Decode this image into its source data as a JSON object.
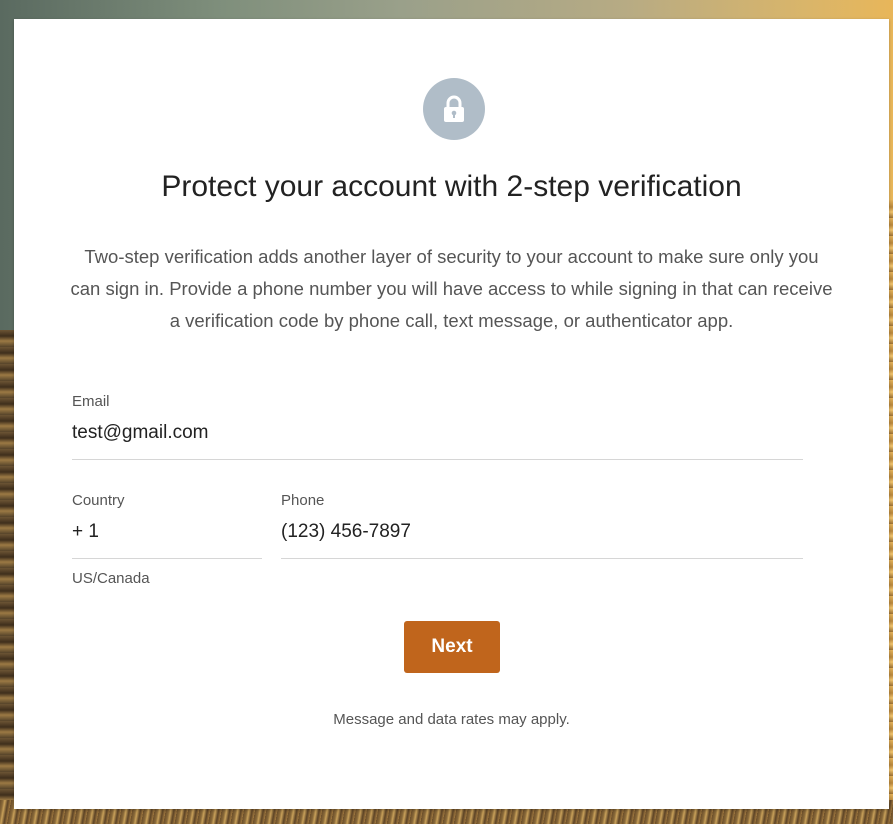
{
  "lock_icon": "lock-icon",
  "title": "Protect your account with 2-step verification",
  "description": "Two-step verification adds another layer of security to your account to make sure only you can sign in. Provide a phone number you will have access to while signing in that can receive a verification code by phone call, text message, or authenticator app.",
  "email": {
    "label": "Email",
    "value": "test@gmail.com"
  },
  "country": {
    "label": "Country",
    "value": "+ 1",
    "helper": "US/Canada"
  },
  "phone": {
    "label": "Phone",
    "value": "(123) 456-7897"
  },
  "next_button_label": "Next",
  "footnote": "Message and data rates may apply.",
  "colors": {
    "accent": "#c0651c",
    "lock_circle": "#b0bdc8"
  }
}
